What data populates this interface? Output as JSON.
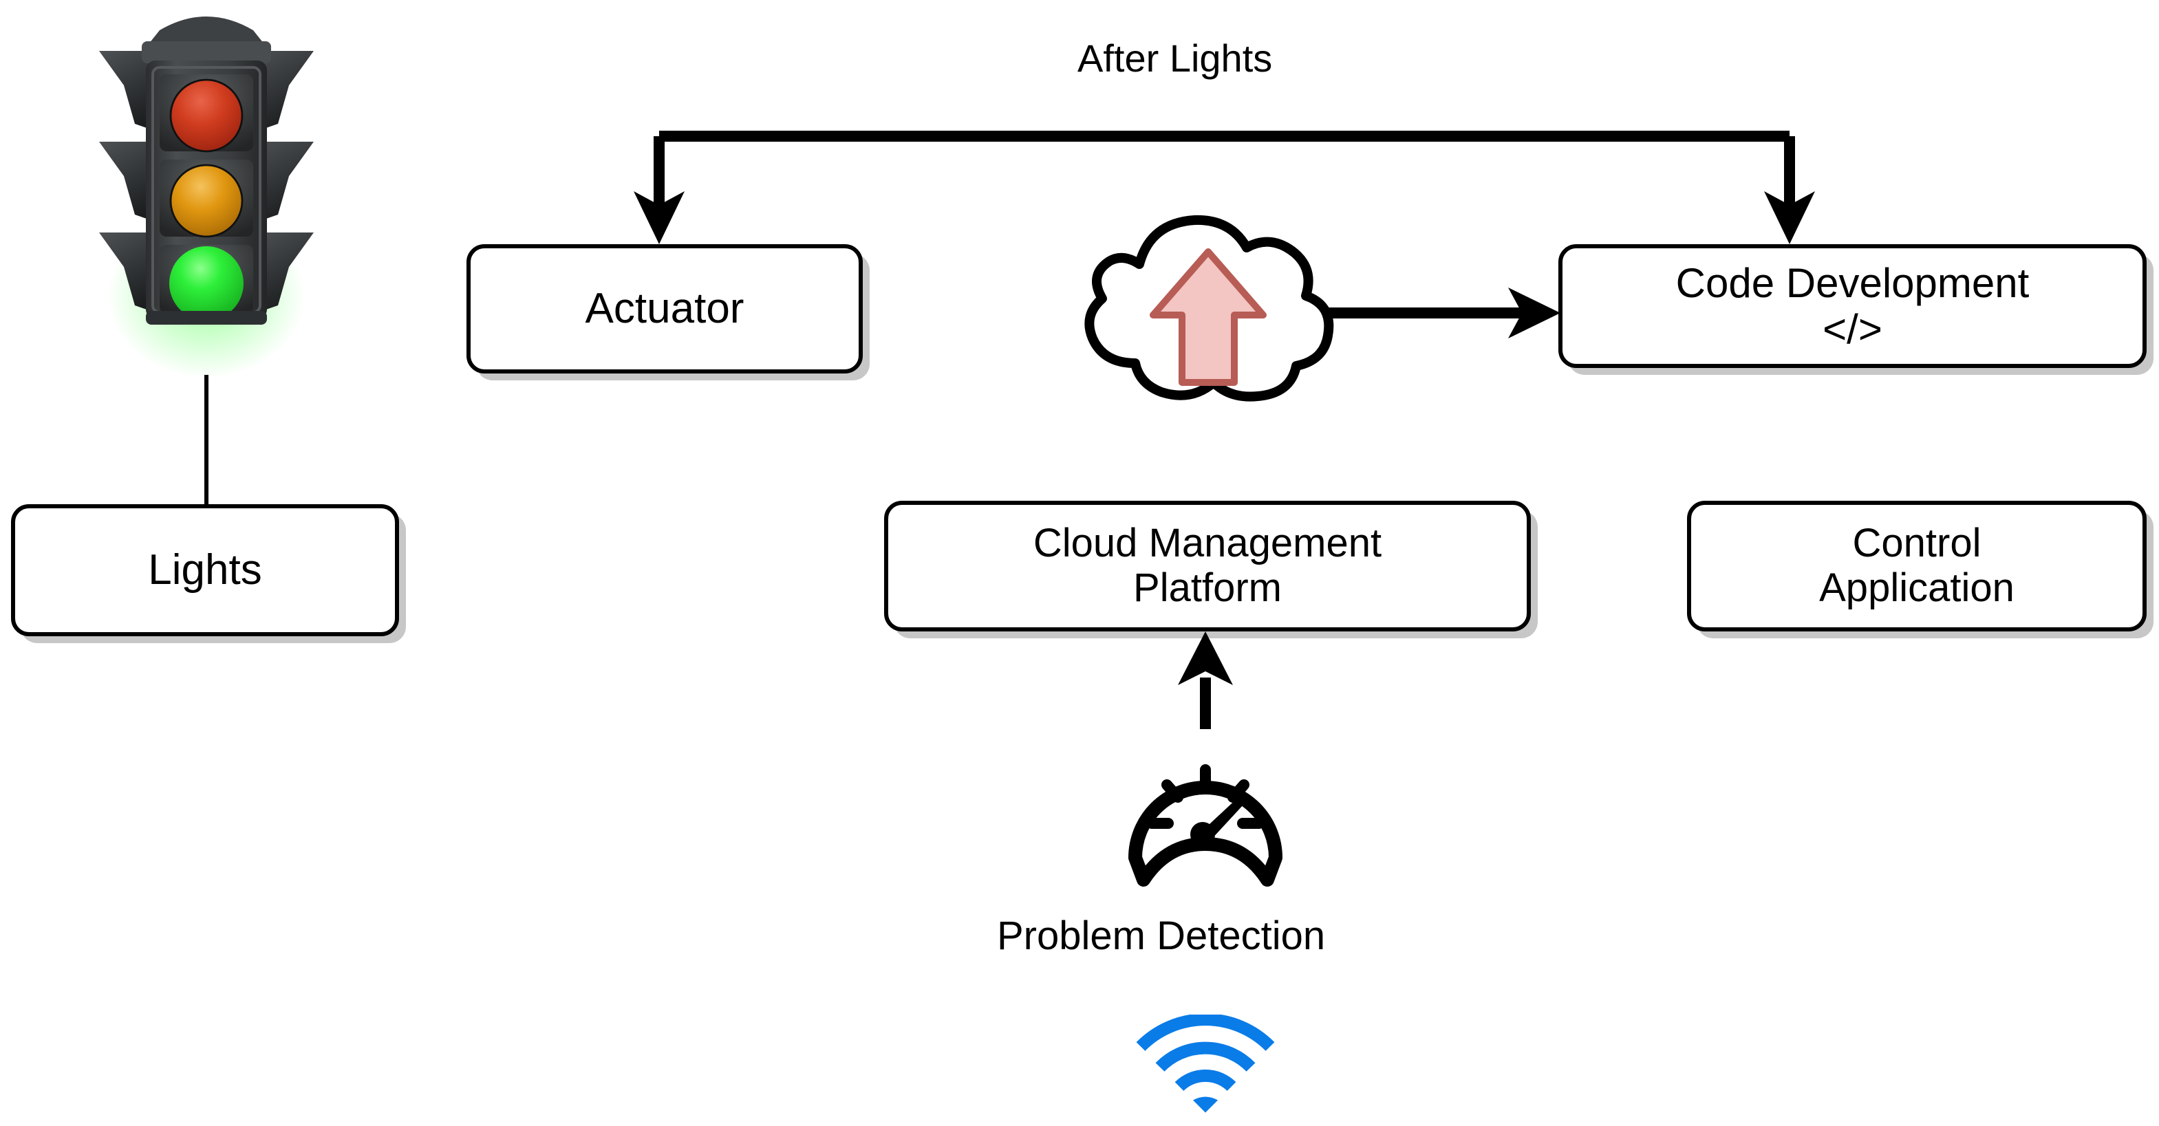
{
  "diagram": {
    "title_label": "After Lights",
    "background_color": "#ffffff",
    "line_color": "#000000",
    "box_border_color": "#000000",
    "box_fill_color": "#ffffff",
    "box_shadow_color": "#c0c0c0"
  },
  "nodes": {
    "lights": {
      "label": "Lights"
    },
    "actuator": {
      "label": "Actuator"
    },
    "code_development": {
      "label": "Code Development\n</>"
    },
    "cloud_management_platform": {
      "label": "Cloud Management\nPlatform"
    },
    "control_application": {
      "label": "Control\nApplication"
    }
  },
  "icons": {
    "traffic_light": {
      "name": "traffic-light-icon",
      "red_color": "#cf3418",
      "amber_color": "#e0960f",
      "green_color": "#22e033",
      "housing_color": "#3c3f41"
    },
    "cloud_upload": {
      "name": "cloud-upload-icon",
      "outline_color": "#000000",
      "arrow_fill_color": "#f3c5c3",
      "arrow_stroke_color": "#b85c56"
    },
    "gauge": {
      "name": "gauge-icon",
      "color": "#000000",
      "caption": "Problem Detection"
    },
    "wifi": {
      "name": "wifi-icon",
      "color": "#0a7ce8"
    }
  },
  "connections": [
    {
      "name": "after-lights-to-actuator",
      "label": "After Lights",
      "from": "after-lights-bus",
      "to": "actuator",
      "arrow": "down"
    },
    {
      "name": "after-lights-to-code-development",
      "label": "After Lights",
      "from": "after-lights-bus",
      "to": "code_development",
      "arrow": "down"
    },
    {
      "name": "cloud-upload-to-code-development",
      "label": "",
      "from": "cloud_upload_icon",
      "to": "code_development",
      "arrow": "right"
    },
    {
      "name": "problem-detection-to-cloud-management-platform",
      "label": "",
      "from": "gauge_icon",
      "to": "cloud_management_platform",
      "arrow": "up"
    },
    {
      "name": "traffic-light-to-lights",
      "label": "",
      "from": "traffic_light_icon",
      "to": "lights",
      "arrow": "none"
    }
  ]
}
